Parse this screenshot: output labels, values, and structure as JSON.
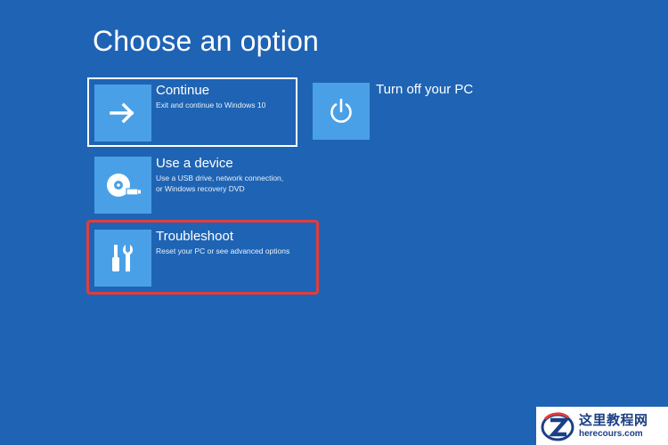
{
  "page": {
    "title": "Choose an option"
  },
  "options": {
    "continue": {
      "icon": "arrow-right-icon",
      "label": "Continue",
      "description": "Exit and continue to Windows 10"
    },
    "turn_off": {
      "icon": "power-icon",
      "label": "Turn off your PC"
    },
    "use_device": {
      "icon": "disc-usb-icon",
      "label": "Use a device",
      "description_lines": [
        "Use a USB drive, network connection,",
        "or Windows recovery DVD"
      ]
    },
    "troubleshoot": {
      "icon": "tools-icon",
      "label": "Troubleshoot",
      "description": "Reset your PC or see advanced options"
    }
  },
  "watermark": {
    "text_cn": "这里教程网",
    "url": "herecours.com"
  },
  "colors": {
    "background": "#1f64b4",
    "tile": "#4aa0e6",
    "focus_border": "#ffffff",
    "highlight_border": "#e23c3c"
  }
}
